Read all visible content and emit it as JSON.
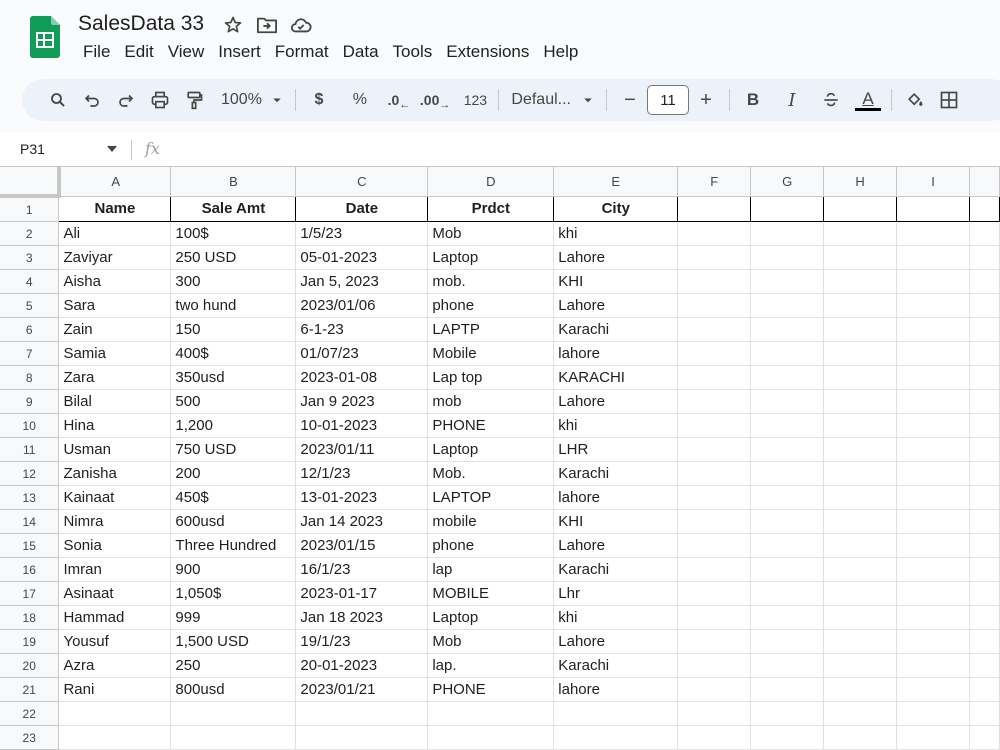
{
  "document": {
    "title": "SalesData 33"
  },
  "menu": [
    "File",
    "Edit",
    "View",
    "Insert",
    "Format",
    "Data",
    "Tools",
    "Extensions",
    "Help"
  ],
  "toolbar": {
    "zoom": "100%",
    "currency": "$",
    "percent": "%",
    "decrease_decimal": ".0",
    "increase_decimal": ".00",
    "number_format": "123",
    "font": "Defaul...",
    "font_size": "11",
    "minus": "−",
    "plus": "+",
    "bold": "B",
    "italic": "I",
    "text_color": "A"
  },
  "formula_bar": {
    "cell_ref": "P31",
    "fx": "fx"
  },
  "columns": [
    "A",
    "B",
    "C",
    "D",
    "E",
    "F",
    "G",
    "H",
    "I"
  ],
  "row_numbers": [
    "1",
    "2",
    "3",
    "4",
    "5",
    "6",
    "7",
    "8",
    "9",
    "10",
    "11",
    "12",
    "13",
    "14",
    "15",
    "16",
    "17",
    "18",
    "19",
    "20",
    "21",
    "22",
    "23"
  ],
  "header_row": [
    "Name",
    "Sale Amt",
    "Date",
    "Prdct",
    "City"
  ],
  "rows": [
    [
      "Ali",
      "100$",
      "1/5/23",
      "Mob",
      "khi"
    ],
    [
      "Zaviyar",
      "250 USD",
      "05-01-2023",
      "Laptop",
      "Lahore"
    ],
    [
      "Aisha",
      "300",
      "Jan 5, 2023",
      "mob.",
      "KHI"
    ],
    [
      "Sara",
      "two hund",
      "2023/01/06",
      "phone",
      "Lahore"
    ],
    [
      "Zain",
      "150",
      "6-1-23",
      "LAPTP",
      "Karachi"
    ],
    [
      "Samia",
      "400$",
      "01/07/23",
      "Mobile",
      "lahore"
    ],
    [
      "Zara",
      "350usd",
      "2023-01-08",
      "Lap top",
      "KARACHI"
    ],
    [
      "Bilal",
      "500",
      "Jan 9 2023",
      "mob",
      "Lahore"
    ],
    [
      "Hina",
      "1,200",
      "10-01-2023",
      "PHONE",
      "khi"
    ],
    [
      "Usman",
      "750 USD",
      "2023/01/11",
      "Laptop",
      "LHR"
    ],
    [
      "Zanisha",
      "200",
      "12/1/23",
      "Mob.",
      "Karachi"
    ],
    [
      "Kainaat",
      "450$",
      "13-01-2023",
      "LAPTOP",
      "lahore"
    ],
    [
      "Nimra",
      "600usd",
      "Jan 14 2023",
      "mobile",
      "KHI"
    ],
    [
      "Sonia",
      "Three Hundred",
      "2023/01/15",
      "phone",
      "Lahore"
    ],
    [
      "Imran",
      "900",
      "16/1/23",
      "lap",
      "Karachi"
    ],
    [
      "Asinaat",
      "1,050$",
      "2023-01-17",
      "MOBILE",
      "Lhr"
    ],
    [
      "Hammad",
      "999",
      "Jan 18 2023",
      "Laptop",
      "khi"
    ],
    [
      "Yousuf",
      "1,500 USD",
      "19/1/23",
      "Mob",
      "Lahore"
    ],
    [
      "Azra",
      "250",
      "20-01-2023",
      "lap.",
      "Karachi"
    ],
    [
      "Rani",
      "800usd",
      "2023/01/21",
      "PHONE",
      "lahore"
    ]
  ]
}
